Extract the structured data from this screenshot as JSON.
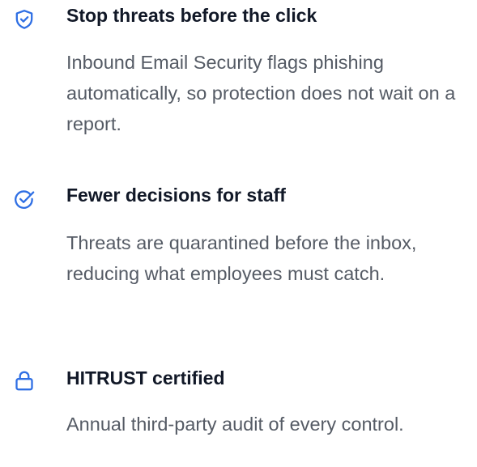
{
  "features": [
    {
      "icon": "shield-check-icon",
      "title": "Stop threats before the click",
      "description": "Inbound Email Security flags phishing automatically, so protection does not wait on a report."
    },
    {
      "icon": "check-circle-icon",
      "title": "Fewer decisions for staff",
      "description": "Threats are quarantined before the inbox, reducing what employees must catch."
    },
    {
      "icon": "lock-icon",
      "title": "HITRUST certified",
      "description": "Annual third-party audit of every control."
    }
  ],
  "colors": {
    "accent": "#2f6fe4",
    "title": "#111827",
    "body": "#555b65"
  }
}
